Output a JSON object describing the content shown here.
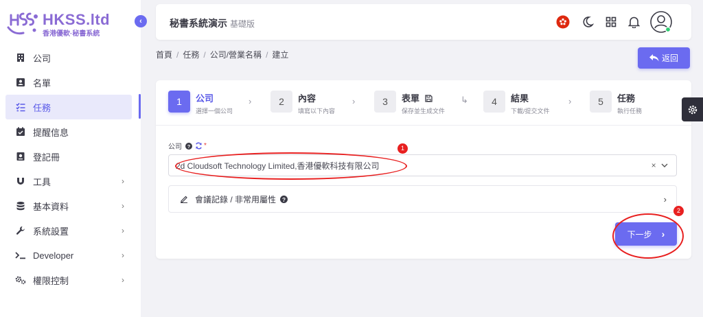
{
  "brand": {
    "title": "HKSS.ltd",
    "subtitle": "香港優軟·秘書系統",
    "color": "#8a6bd4"
  },
  "sidebar": {
    "items": [
      {
        "label": "公司",
        "icon": "building-icon",
        "has_children": false,
        "active": false
      },
      {
        "label": "名單",
        "icon": "contact-card-icon",
        "has_children": false,
        "active": false
      },
      {
        "label": "任務",
        "icon": "task-list-icon",
        "has_children": false,
        "active": true
      },
      {
        "label": "提醒信息",
        "icon": "calendar-check-icon",
        "has_children": false,
        "active": false
      },
      {
        "label": "登記冊",
        "icon": "register-book-icon",
        "has_children": false,
        "active": false
      },
      {
        "label": "工具",
        "icon": "magnet-icon",
        "has_children": true,
        "active": false
      },
      {
        "label": "基本資料",
        "icon": "database-icon",
        "has_children": true,
        "active": false
      },
      {
        "label": "系統設置",
        "icon": "wrench-icon",
        "has_children": true,
        "active": false
      },
      {
        "label": "Developer",
        "icon": "terminal-icon",
        "has_children": true,
        "active": false
      },
      {
        "label": "權限控制",
        "icon": "gears-icon",
        "has_children": true,
        "active": false
      }
    ]
  },
  "header": {
    "title": "秘書系統演示",
    "subtitle": "基礎版"
  },
  "breadcrumb": [
    "首頁",
    "任務",
    "公司/營業名稱",
    "建立"
  ],
  "back_label": "返回",
  "steps": [
    {
      "num": "1",
      "title": "公司",
      "desc": "選擇一個公司",
      "active": true
    },
    {
      "num": "2",
      "title": "內容",
      "desc": "填寫以下內容",
      "active": false
    },
    {
      "num": "3",
      "title": "表單",
      "desc": "保存並生成文件",
      "active": false
    },
    {
      "num": "4",
      "title": "結果",
      "desc": "下載/提交文件",
      "active": false
    },
    {
      "num": "5",
      "title": "任務",
      "desc": "執行任務",
      "active": false
    }
  ],
  "form": {
    "company_label": "公司",
    "required_mark": "*",
    "company_value": "2d Cloudsoft Technology Limited,香港優軟科技有限公司",
    "clear_symbol": "×",
    "collapse_label": "會議記錄 / 非常用屬性",
    "next_label": "下一步"
  },
  "annotations": {
    "badge1": "1",
    "badge2": "2",
    "color": "#e82020"
  },
  "colors": {
    "accent": "#6b6bf0",
    "background": "#f2f2f6"
  }
}
